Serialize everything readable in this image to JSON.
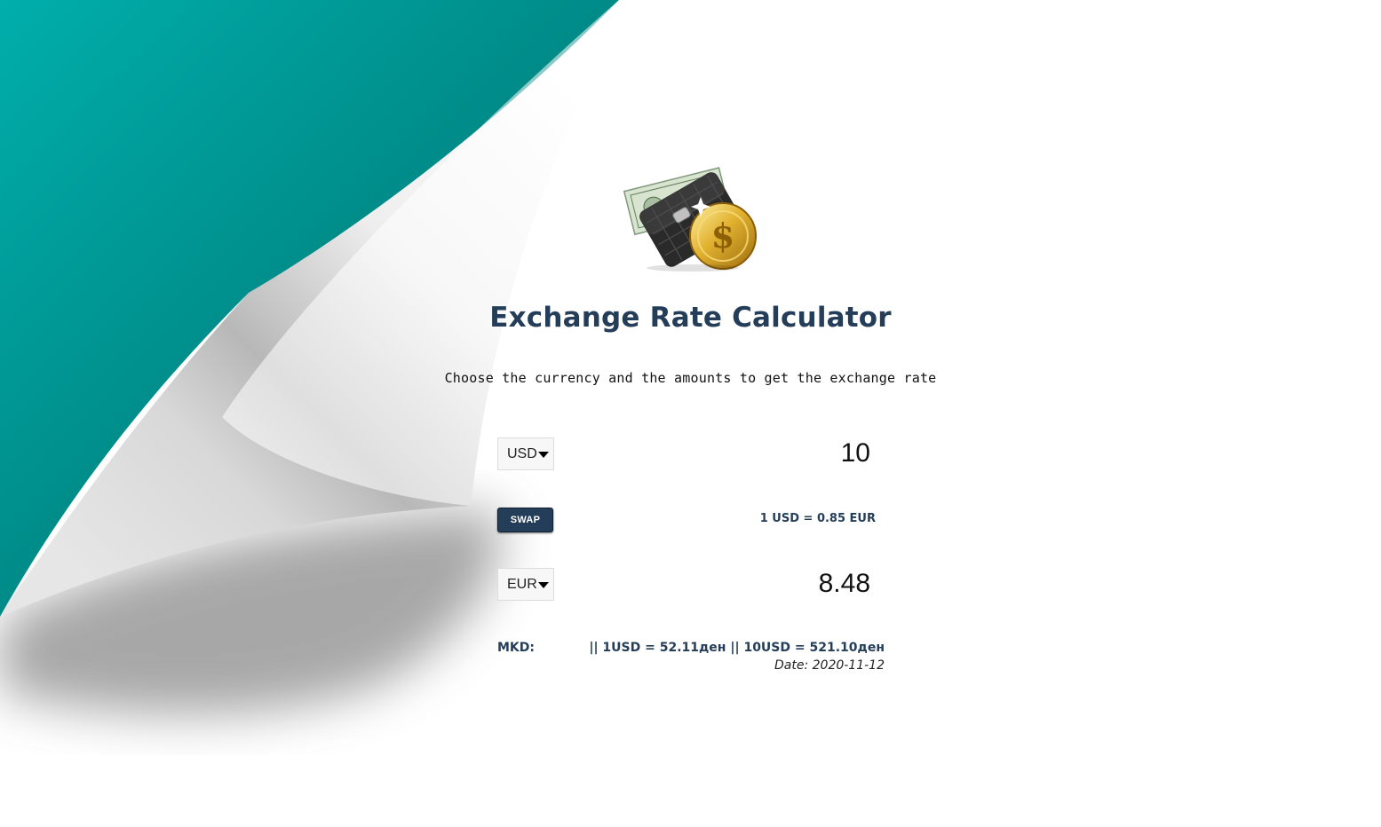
{
  "page": {
    "title": "Exchange Rate Calculator",
    "subtitle": "Choose the currency and the amounts to get the exchange rate"
  },
  "colors": {
    "teal": "#008b87",
    "teal_light": "#00aeab",
    "title": "#243e5a",
    "button": "#243e5a"
  },
  "logo": {
    "icon": "wallet-dollar-coin-icon"
  },
  "converter": {
    "from_currency": "USD",
    "from_amount": "10",
    "swap_label": "SWAP",
    "rate_text": "1 USD = 0.85 EUR",
    "to_currency": "EUR",
    "to_amount": "8.48"
  },
  "mkd": {
    "label": "MKD:",
    "values": "|| 1USD = 52.11ден || 10USD = 521.10ден",
    "date": "Date: 2020-11-12"
  }
}
